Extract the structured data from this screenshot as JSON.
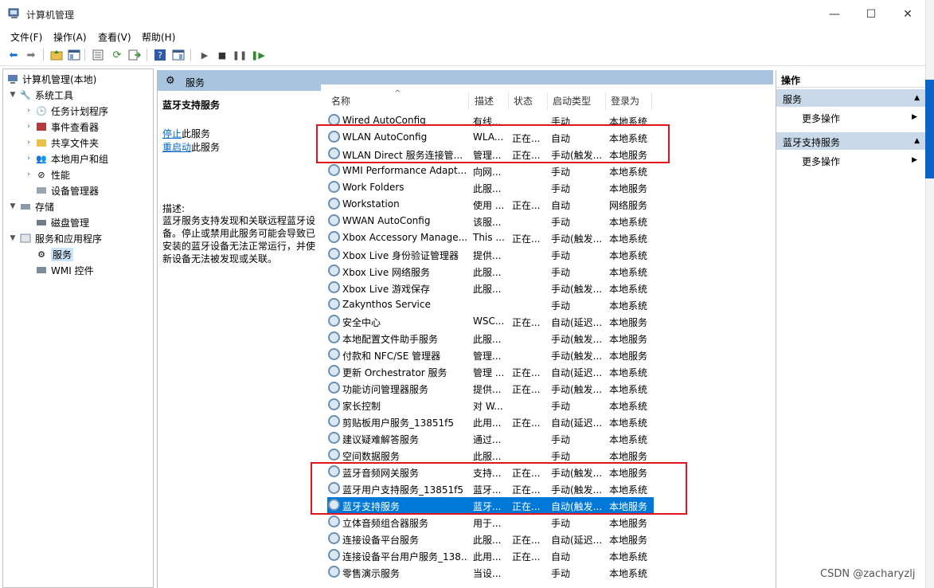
{
  "window": {
    "title": "计算机管理",
    "min": "—",
    "max": "☐",
    "close": "✕"
  },
  "menu": {
    "file": "文件(F)",
    "action": "操作(A)",
    "view": "查看(V)",
    "help": "帮助(H)"
  },
  "tree": {
    "root": "计算机管理(本地)",
    "system_tools": "系统工具",
    "task_scheduler": "任务计划程序",
    "event_viewer": "事件查看器",
    "shared_folders": "共享文件夹",
    "local_users": "本地用户和组",
    "performance": "性能",
    "device_manager": "设备管理器",
    "storage": "存储",
    "disk_management": "磁盘管理",
    "services_apps": "服务和应用程序",
    "services": "服务",
    "wmi": "WMI 控件"
  },
  "middle": {
    "header": "服务",
    "selected_service": "蓝牙支持服务",
    "stop_link": "停止",
    "stop_suffix": "此服务",
    "restart_link": "重启动",
    "restart_suffix": "此服务",
    "desc_label": "描述:",
    "desc_body": "蓝牙服务支持发现和关联远程蓝牙设备。停止或禁用此服务可能会导致已安装的蓝牙设备无法正常运行，并使新设备无法被发现或关联。"
  },
  "columns": {
    "name": "名称",
    "desc": "描述",
    "state": "状态",
    "start": "启动类型",
    "logon": "登录为"
  },
  "rows": [
    {
      "name": "Wired AutoConfig",
      "desc": "有线...",
      "state": "",
      "start": "手动",
      "logon": "本地系统"
    },
    {
      "name": "WLAN AutoConfig",
      "desc": "WLA...",
      "state": "正在...",
      "start": "自动",
      "logon": "本地系统"
    },
    {
      "name": "WLAN Direct 服务连接管...",
      "desc": "管理...",
      "state": "正在...",
      "start": "手动(触发...",
      "logon": "本地服务"
    },
    {
      "name": "WMI Performance Adapt...",
      "desc": "向网...",
      "state": "",
      "start": "手动",
      "logon": "本地系统"
    },
    {
      "name": "Work Folders",
      "desc": "此服...",
      "state": "",
      "start": "手动",
      "logon": "本地服务"
    },
    {
      "name": "Workstation",
      "desc": "使用 ...",
      "state": "正在...",
      "start": "自动",
      "logon": "网络服务"
    },
    {
      "name": "WWAN AutoConfig",
      "desc": "该服...",
      "state": "",
      "start": "手动",
      "logon": "本地系统"
    },
    {
      "name": "Xbox Accessory Manage...",
      "desc": "This ...",
      "state": "正在...",
      "start": "手动(触发...",
      "logon": "本地系统"
    },
    {
      "name": "Xbox Live 身份验证管理器",
      "desc": "提供...",
      "state": "",
      "start": "手动",
      "logon": "本地系统"
    },
    {
      "name": "Xbox Live 网络服务",
      "desc": "此服...",
      "state": "",
      "start": "手动",
      "logon": "本地系统"
    },
    {
      "name": "Xbox Live 游戏保存",
      "desc": "此服...",
      "state": "",
      "start": "手动(触发...",
      "logon": "本地系统"
    },
    {
      "name": "Zakynthos Service",
      "desc": "",
      "state": "",
      "start": "手动",
      "logon": "本地系统"
    },
    {
      "name": "安全中心",
      "desc": "WSC...",
      "state": "正在...",
      "start": "自动(延迟...",
      "logon": "本地服务"
    },
    {
      "name": "本地配置文件助手服务",
      "desc": "此服...",
      "state": "",
      "start": "手动(触发...",
      "logon": "本地服务"
    },
    {
      "name": "付款和 NFC/SE 管理器",
      "desc": "管理...",
      "state": "",
      "start": "手动(触发...",
      "logon": "本地服务"
    },
    {
      "name": "更新 Orchestrator 服务",
      "desc": "管理 ...",
      "state": "正在...",
      "start": "自动(延迟...",
      "logon": "本地系统"
    },
    {
      "name": "功能访问管理器服务",
      "desc": "提供...",
      "state": "正在...",
      "start": "手动(触发...",
      "logon": "本地系统"
    },
    {
      "name": "家长控制",
      "desc": "对 W...",
      "state": "",
      "start": "手动",
      "logon": "本地系统"
    },
    {
      "name": "剪贴板用户服务_13851f5",
      "desc": "此用...",
      "state": "正在...",
      "start": "自动(延迟...",
      "logon": "本地系统"
    },
    {
      "name": "建议疑难解答服务",
      "desc": "通过...",
      "state": "",
      "start": "手动",
      "logon": "本地系统"
    },
    {
      "name": "空间数据服务",
      "desc": "此服...",
      "state": "",
      "start": "手动",
      "logon": "本地服务"
    },
    {
      "name": "蓝牙音频网关服务",
      "desc": "支持...",
      "state": "正在...",
      "start": "手动(触发...",
      "logon": "本地服务"
    },
    {
      "name": "蓝牙用户支持服务_13851f5",
      "desc": "蓝牙...",
      "state": "正在...",
      "start": "手动(触发...",
      "logon": "本地系统"
    },
    {
      "name": "蓝牙支持服务",
      "desc": "蓝牙...",
      "state": "正在...",
      "start": "自动(触发...",
      "logon": "本地服务"
    },
    {
      "name": "立体音频组合器服务",
      "desc": "用于...",
      "state": "",
      "start": "手动",
      "logon": "本地服务"
    },
    {
      "name": "连接设备平台服务",
      "desc": "此服...",
      "state": "正在...",
      "start": "自动(延迟...",
      "logon": "本地服务"
    },
    {
      "name": "连接设备平台用户服务_138...",
      "desc": "此用...",
      "state": "正在...",
      "start": "自动",
      "logon": "本地系统"
    },
    {
      "name": "零售演示服务",
      "desc": "当设...",
      "state": "",
      "start": "手动",
      "logon": "本地系统"
    }
  ],
  "actions": {
    "title": "操作",
    "section1": "服务",
    "more1": "更多操作",
    "section2": "蓝牙支持服务",
    "more2": "更多操作"
  },
  "watermark": "CSDN @zacharyzlj",
  "colors": {
    "highlight": "#0078d7",
    "header_bar": "#a9c4de",
    "annotation": "#e0141e"
  }
}
